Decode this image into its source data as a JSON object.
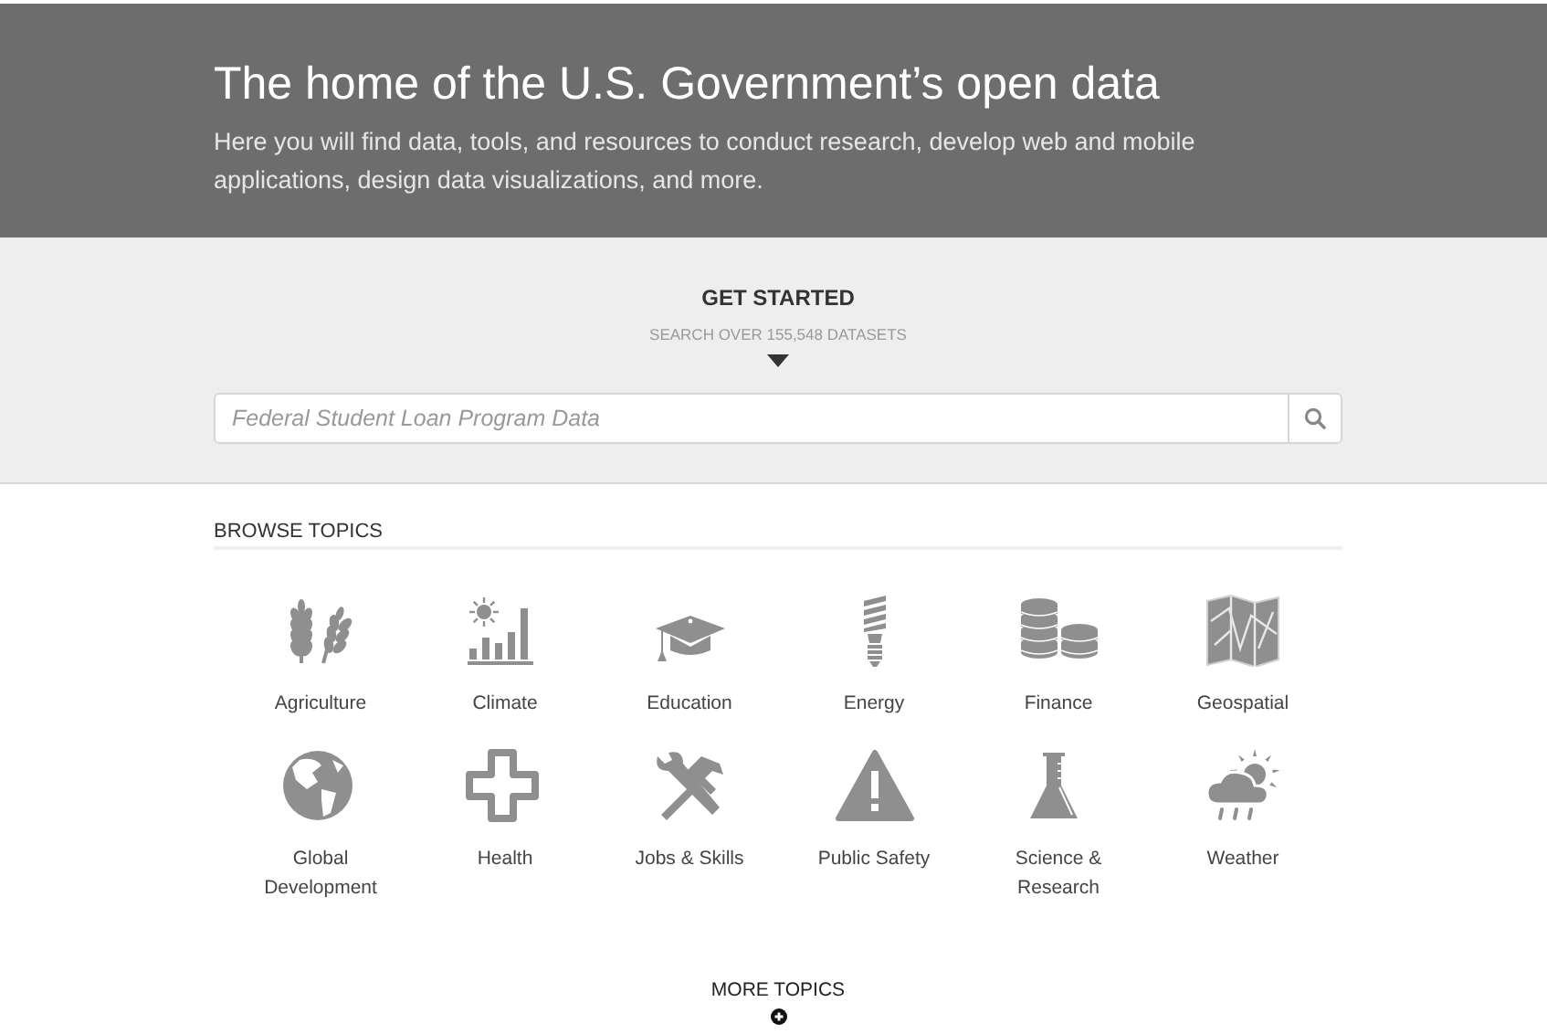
{
  "hero": {
    "title": "The home of the U.S. Government’s open data",
    "subtitle": "Here you will find data, tools, and resources to conduct research, develop web and mobile applications, design data visualizations, and more."
  },
  "get_started": {
    "heading": "GET STARTED",
    "subheading": "SEARCH OVER 155,548 DATASETS",
    "search": {
      "placeholder": "Federal Student Loan Program Data"
    }
  },
  "browse": {
    "heading": "BROWSE TOPICS",
    "topics": [
      {
        "label": "Agriculture",
        "kind": "agriculture"
      },
      {
        "label": "Climate",
        "kind": "climate"
      },
      {
        "label": "Education",
        "kind": "education"
      },
      {
        "label": "Energy",
        "kind": "energy"
      },
      {
        "label": "Finance",
        "kind": "finance"
      },
      {
        "label": "Geospatial",
        "kind": "geospatial"
      },
      {
        "label": "Global Development",
        "kind": "global"
      },
      {
        "label": "Health",
        "kind": "health"
      },
      {
        "label": "Jobs & Skills",
        "kind": "jobs"
      },
      {
        "label": "Public Safety",
        "kind": "safety"
      },
      {
        "label": "Science & Research",
        "kind": "science"
      },
      {
        "label": "Weather",
        "kind": "weather"
      }
    ],
    "more": "MORE TOPICS"
  }
}
